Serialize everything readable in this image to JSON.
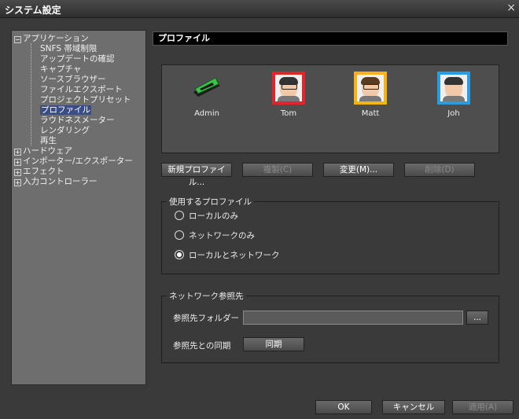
{
  "window": {
    "title": "システム設定",
    "close": "×"
  },
  "tree": {
    "items": [
      {
        "label": "アプリケーション",
        "level": 0,
        "expander": "−"
      },
      {
        "label": "SNFS 帯域制限",
        "level": 1
      },
      {
        "label": "アップデートの確認",
        "level": 1
      },
      {
        "label": "キャプチャ",
        "level": 1
      },
      {
        "label": "ソースブラウザー",
        "level": 1
      },
      {
        "label": "ファイルエクスポート",
        "level": 1
      },
      {
        "label": "プロジェクトプリセット",
        "level": 1
      },
      {
        "label": "プロファイル",
        "level": 1,
        "selected": true
      },
      {
        "label": "ラウドネスメーター",
        "level": 1
      },
      {
        "label": "レンダリング",
        "level": 1
      },
      {
        "label": "再生",
        "level": 1
      },
      {
        "label": "ハードウェア",
        "level": 0,
        "expander": "+"
      },
      {
        "label": "インポーター/エクスポーター",
        "level": 0,
        "expander": "+"
      },
      {
        "label": "エフェクト",
        "level": 0,
        "expander": "+"
      },
      {
        "label": "入力コントローラー",
        "level": 0,
        "expander": "+"
      }
    ]
  },
  "section": {
    "title": "プロファイル"
  },
  "profiles": [
    {
      "name": "Admin",
      "icon": "edius-logo-icon"
    },
    {
      "name": "Tom",
      "icon": "avatar-red-icon",
      "color": "#e0262a"
    },
    {
      "name": "Matt",
      "icon": "avatar-orange-icon",
      "color": "#f5b318"
    },
    {
      "name": "Joh",
      "icon": "avatar-blue-icon",
      "color": "#2a9de0"
    }
  ],
  "profile_buttons": {
    "new": "新規プロファイル...",
    "copy": "複製(C)",
    "change": "変更(M)...",
    "delete": "削除(D)"
  },
  "use_profile": {
    "legend": "使用するプロファイル",
    "options": [
      "ローカルのみ",
      "ネットワークのみ",
      "ローカルとネットワーク"
    ],
    "selected_index": 2
  },
  "network": {
    "legend": "ネットワーク参照先",
    "folder_label": "参照先フォルダー",
    "folder_value": "",
    "browse": "...",
    "sync_label": "参照先との同期",
    "sync_button": "同期"
  },
  "footer": {
    "ok": "OK",
    "cancel": "キャンセル",
    "apply": "適用(A)"
  }
}
